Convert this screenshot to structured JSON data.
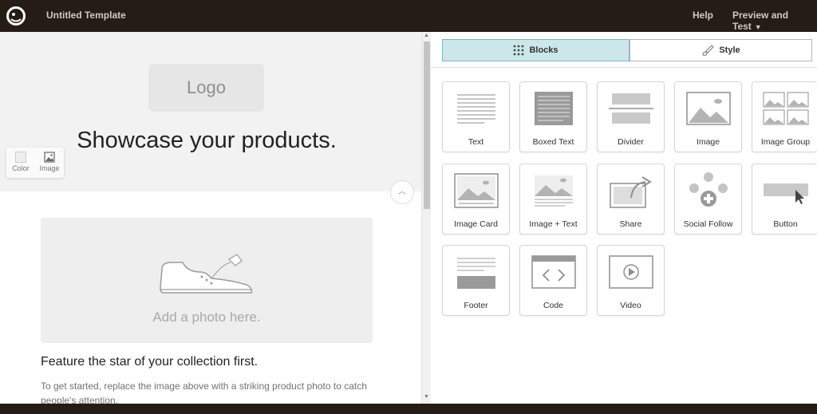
{
  "topbar": {
    "logo_icon": "mailchimp-logo-icon",
    "title": "Untitled Template",
    "help": "Help",
    "preview": "Preview and Test"
  },
  "editor": {
    "logo_placeholder": "Logo",
    "hero_title": "Showcase your products.",
    "bg_options": [
      "Color",
      "Image"
    ],
    "photo_placeholder": "Add a photo here.",
    "feature_title": "Feature the star of your collection first.",
    "feature_desc": "To get started, replace the image above with a striking product photo to catch people's attention."
  },
  "panel": {
    "tabs": [
      {
        "label": "Blocks",
        "icon": "grid-dots-icon",
        "active": true
      },
      {
        "label": "Style",
        "icon": "paint-brush-icon",
        "active": false
      }
    ],
    "blocks": [
      {
        "label": "Text"
      },
      {
        "label": "Boxed Text"
      },
      {
        "label": "Divider"
      },
      {
        "label": "Image"
      },
      {
        "label": "Image Group"
      },
      {
        "label": "Image Card"
      },
      {
        "label": "Image + Text"
      },
      {
        "label": "Share"
      },
      {
        "label": "Social Follow"
      },
      {
        "label": "Button"
      },
      {
        "label": "Footer"
      },
      {
        "label": "Code"
      },
      {
        "label": "Video"
      }
    ]
  },
  "colors": {
    "topbar": "#241c15",
    "active_tab": "#cce7ea",
    "icon_gray": "#b9b9b9"
  }
}
